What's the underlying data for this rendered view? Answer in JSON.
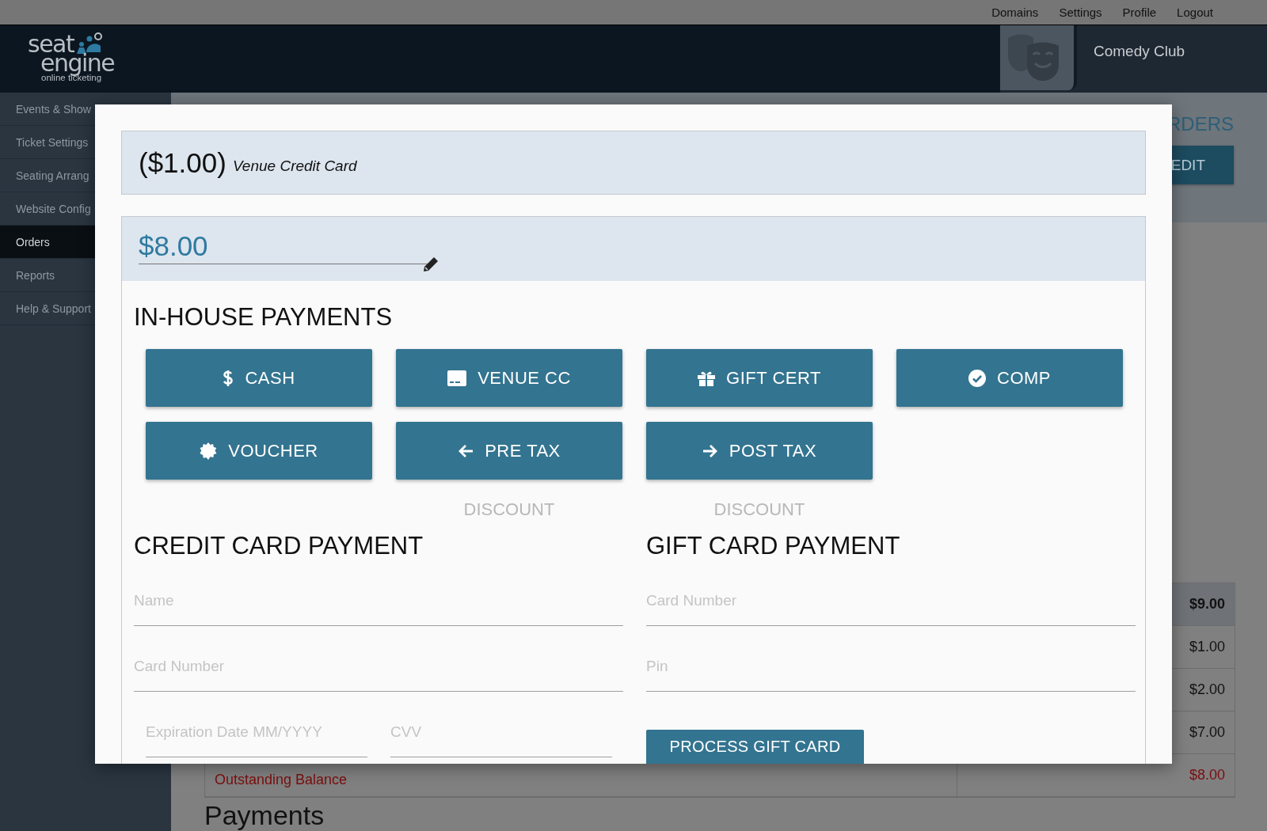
{
  "top_links": [
    {
      "label": "Domains"
    },
    {
      "label": "Settings"
    },
    {
      "label": "Profile"
    },
    {
      "label": "Logout"
    }
  ],
  "brand": {
    "word_1": "seat",
    "word_2": "engine",
    "tagline": "online ticketing"
  },
  "venue": {
    "name": "Comedy Club"
  },
  "sidebar": {
    "items": [
      {
        "label": "Events & Show",
        "selected": false
      },
      {
        "label": "Ticket Settings",
        "selected": false
      },
      {
        "label": "Seating Arrang",
        "selected": false
      },
      {
        "label": "Website Config",
        "selected": false
      },
      {
        "label": "Orders",
        "selected": true
      },
      {
        "label": "Reports",
        "selected": false
      },
      {
        "label": "Help & Support",
        "selected": false
      }
    ]
  },
  "page": {
    "title": "RDERS",
    "edit_button": "EDIT",
    "payments_heading": "Payments",
    "totals": [
      {
        "kind": "total",
        "value": "$9.00"
      },
      {
        "kind": "plain",
        "value": "$1.00"
      },
      {
        "kind": "plain",
        "value": "$2.00"
      },
      {
        "kind": "plain",
        "value": "$7.00"
      },
      {
        "kind": "balance",
        "label": "Outstanding Balance",
        "value": "$8.00"
      }
    ]
  },
  "modal": {
    "summary": {
      "amount": "($1.00)",
      "method": "Venue Credit Card"
    },
    "amount_field": {
      "value": "$8.00"
    },
    "in_house": {
      "title": "IN-HOUSE PAYMENTS",
      "buttons": [
        {
          "label": "CASH"
        },
        {
          "label": "VENUE CC"
        },
        {
          "label": "GIFT CERT"
        },
        {
          "label": "COMP"
        },
        {
          "label": "VOUCHER"
        },
        {
          "label": "PRE TAX",
          "note": "DISCOUNT"
        },
        {
          "label": "POST TAX",
          "note": "DISCOUNT"
        }
      ]
    },
    "credit_card": {
      "title": "CREDIT CARD PAYMENT",
      "fields": [
        {
          "placeholder": "Name"
        },
        {
          "placeholder": "Card Number"
        }
      ],
      "split_fields": [
        {
          "placeholder": "Expiration Date MM/YYYY"
        },
        {
          "placeholder": "CVV"
        }
      ]
    },
    "gift_card": {
      "title": "GIFT CARD PAYMENT",
      "fields": [
        {
          "placeholder": "Card Number"
        },
        {
          "placeholder": "Pin"
        }
      ],
      "button": "PROCESS GIFT CARD"
    }
  }
}
